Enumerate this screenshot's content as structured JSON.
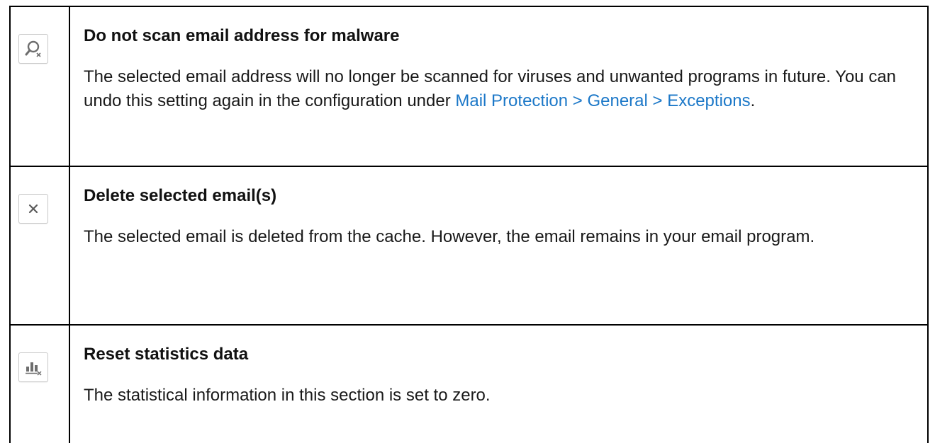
{
  "rows": [
    {
      "icon": "search-exclude-icon",
      "title": "Do not scan email address for malware",
      "body_before": "The selected email address will no longer be scanned for viruses and unwanted programs in future. You can undo this setting again in the configuration under ",
      "link": "Mail Protection > General > Exceptions",
      "body_after": "."
    },
    {
      "icon": "close-icon",
      "title": "Delete selected email(s)",
      "body": "The selected email is deleted from the cache. However, the email remains in your email program."
    },
    {
      "icon": "chart-reset-icon",
      "title": "Reset statistics data",
      "body": "The statistical information in this section is set to zero."
    }
  ],
  "colors": {
    "link": "#1c78c8",
    "border": "#000000",
    "icon_gray": "#707070"
  }
}
